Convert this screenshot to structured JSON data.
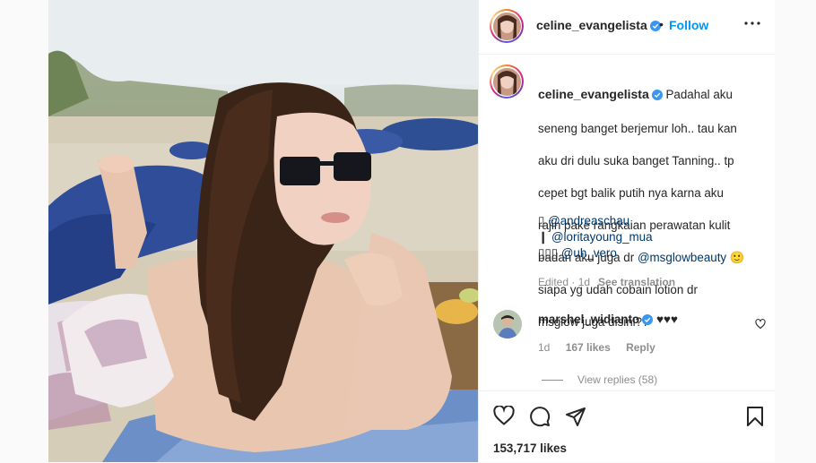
{
  "post": {
    "username": "celine_evangelista",
    "follow_label": "Follow",
    "separator": "•",
    "caption_lines": [
      "Padahal aku",
      "seneng banget berjemur loh.. tau kan",
      "aku dri dulu suka banget Tanning.. tp",
      "cepet bgt balik putih nya karna aku",
      "rajin pake rangkaian perawatan kulit"
    ],
    "caption_line6_prefix": "badan aku juga dr ",
    "caption_mention": "@msglowbeauty",
    "caption_emoji": "🙂",
    "caption_line7": "siapa yg udah cobain lotion dr",
    "caption_line8": "msglow juga disini??",
    "credits": [
      {
        "icon": "▯",
        "handle": "@andreaschau"
      },
      {
        "icon": "❙",
        "handle": "@loritayoung_mua"
      },
      {
        "icon": "▯▯▯",
        "handle": "@uh_vero"
      }
    ],
    "edited": "Edited · 1d",
    "see_translation": "See translation"
  },
  "comment": {
    "username": "marshel_widianto",
    "text": "♥♥♥",
    "age": "1d",
    "likes": "167 likes",
    "reply": "Reply",
    "view_replies": "View replies (58)"
  },
  "footer": {
    "likes": "153,717 likes"
  },
  "colors": {
    "accent": "#0095f6",
    "verified": "#3897f0",
    "mention": "#00376b"
  }
}
